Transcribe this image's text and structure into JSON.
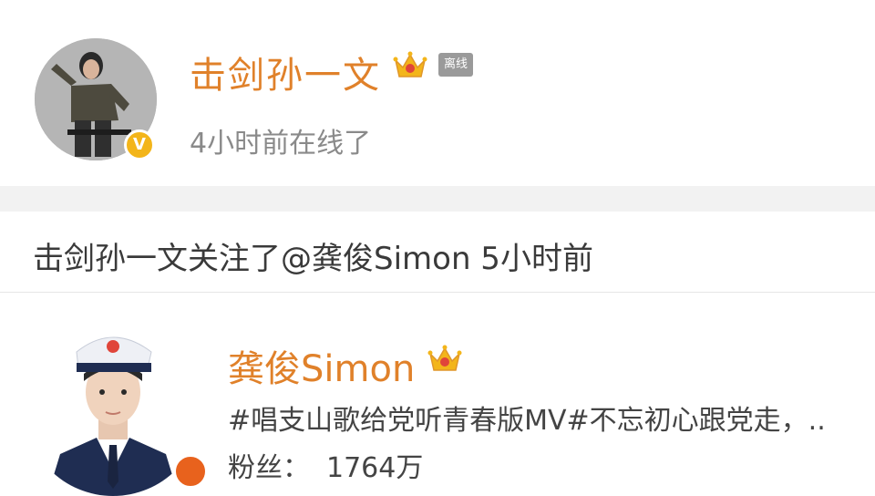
{
  "profile": {
    "name": "击剑孙一文",
    "status_badge": "离线",
    "last_online": "4小时前在线了",
    "crown_icon": "vip-crown-icon",
    "verified_icon": "verified-v-icon",
    "accent_color": "#e0812a",
    "verified_color": "#f3b51a"
  },
  "activity": {
    "text": "击剑孙一文关注了@龚俊Simon 5小时前"
  },
  "followed_user": {
    "name": "龚俊Simon",
    "description": "#唱支山歌给党听青春版MV#不忘初心跟党走，..",
    "fans_label": "粉丝：",
    "fans_count": "1764万",
    "verified_color": "#e8621d"
  }
}
